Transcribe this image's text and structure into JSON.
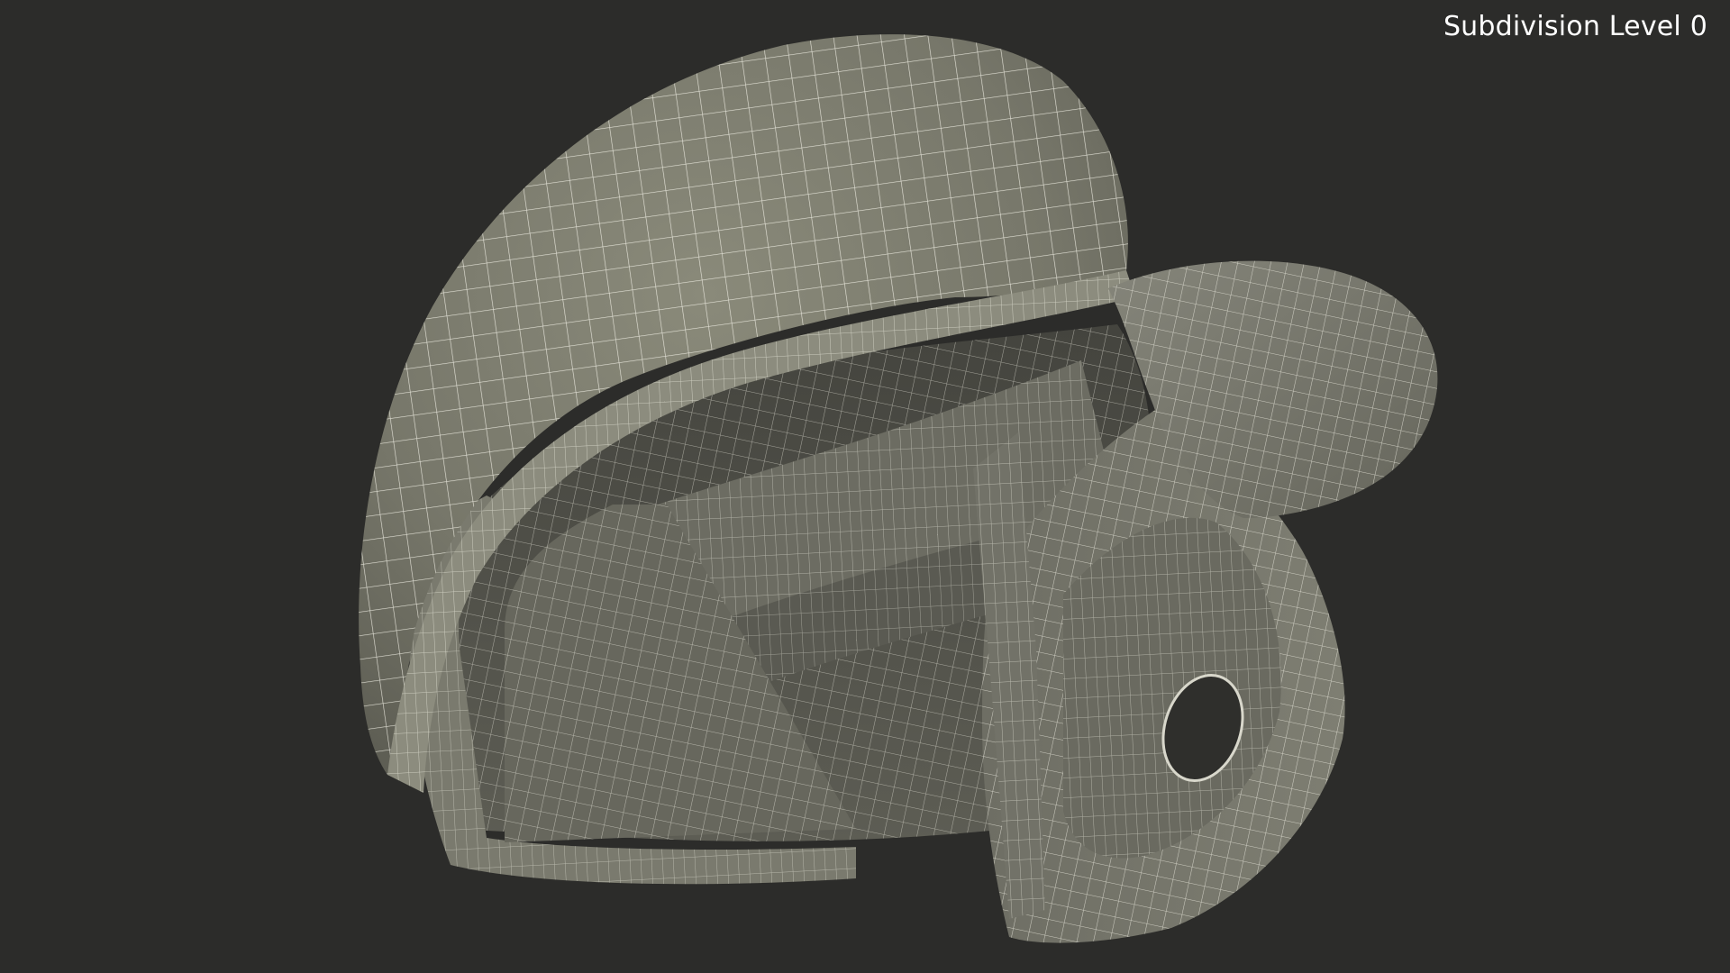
{
  "viewport": {
    "label": "Subdivision Level 0"
  },
  "model": {
    "subject": "helmet-icon",
    "surface_color": "#7b7b6c",
    "wire_color": "#f2f1e6",
    "background_color": "#2c2c2a"
  }
}
